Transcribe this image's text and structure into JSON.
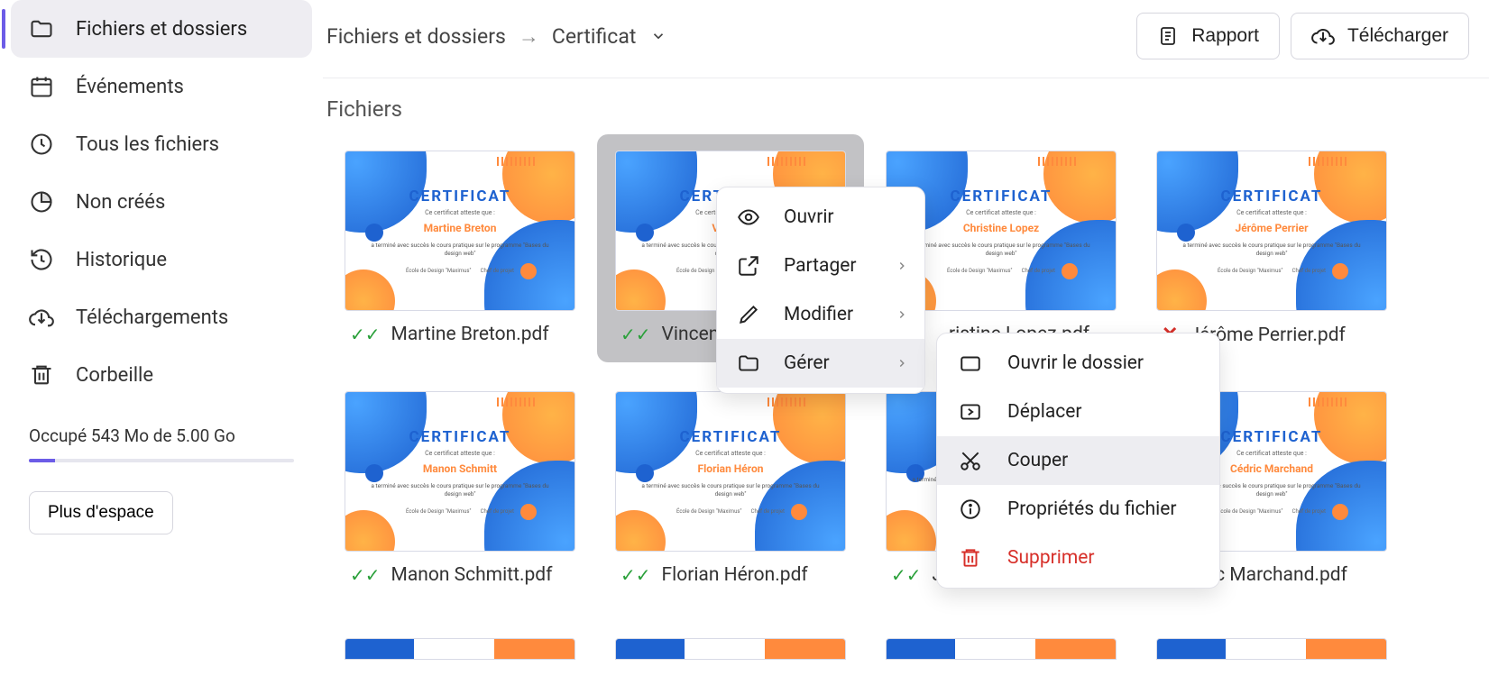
{
  "sidebar": {
    "items": [
      {
        "label": "Fichiers et dossiers",
        "icon": "folder"
      },
      {
        "label": "Événements",
        "icon": "calendar"
      },
      {
        "label": "Tous les fichiers",
        "icon": "clock"
      },
      {
        "label": "Non créés",
        "icon": "pie"
      },
      {
        "label": "Historique",
        "icon": "history"
      },
      {
        "label": "Téléchargements",
        "icon": "download"
      },
      {
        "label": "Corbeille",
        "icon": "trash"
      }
    ],
    "storage_text": "Occupé 543 Mo de 5.00 Go",
    "more_space": "Plus d'espace"
  },
  "breadcrumb": {
    "root": "Fichiers et dossiers",
    "current": "Certificat"
  },
  "top_actions": {
    "report": "Rapport",
    "download": "Télécharger"
  },
  "section_title": "Fichiers",
  "certificate": {
    "heading": "CERTIFICAT",
    "sub": "Ce certificat atteste que :",
    "body": "a terminé avec succès le cours pratique sur le programme \"Bases du design web\"",
    "school": "École de Design \"Maximus\"",
    "role": "Chef de projet"
  },
  "files": [
    {
      "name": "Martine Breton",
      "filename": "Martine Breton.pdf",
      "status": "ok"
    },
    {
      "name": "Vincent",
      "filename": "Vincent",
      "status": "ok",
      "selected": true
    },
    {
      "name": "Christine Lopez",
      "filename": "Christine Lopez.pdf",
      "status": "ok",
      "label_override": "ristine Lopez.pdf"
    },
    {
      "name": "Jérôme Perrier",
      "filename": "Jérôme Perrier.pdf",
      "status": "fail"
    },
    {
      "name": "Manon Schmitt",
      "filename": "Manon Schmitt.pdf",
      "status": "ok"
    },
    {
      "name": "Florian Héron",
      "filename": "Florian Héron.pdf",
      "status": "ok"
    },
    {
      "name": "J",
      "filename": "J",
      "status": "ok"
    },
    {
      "name": "Cédric Marchand",
      "filename": "ic Marchand.pdf",
      "status": "none"
    }
  ],
  "context_menu": [
    {
      "label": "Ouvrir",
      "icon": "eye"
    },
    {
      "label": "Partager",
      "icon": "share",
      "submenu": true
    },
    {
      "label": "Modifier",
      "icon": "pencil",
      "submenu": true
    },
    {
      "label": "Gérer",
      "icon": "folder",
      "submenu": true,
      "hover": true
    }
  ],
  "submenu": [
    {
      "label": "Ouvrir le dossier",
      "icon": "folder-outline"
    },
    {
      "label": "Déplacer",
      "icon": "move"
    },
    {
      "label": "Couper",
      "icon": "cut",
      "hover": true
    },
    {
      "label": "Propriétés du fichier",
      "icon": "info"
    },
    {
      "label": "Supprimer",
      "icon": "trash",
      "danger": true
    }
  ]
}
